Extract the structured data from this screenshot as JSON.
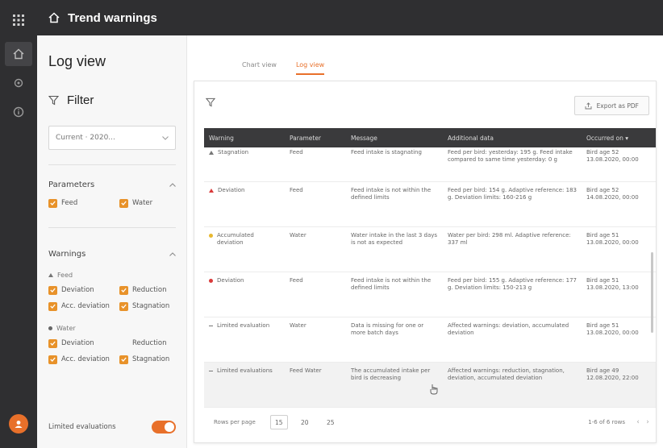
{
  "app": {
    "title": "Trend warnings"
  },
  "sidebar": {
    "page_title": "Log view",
    "filter_label": "Filter",
    "select_value": "Current · 2020...",
    "parameters": {
      "label": "Parameters",
      "items": [
        "Feed",
        "Water"
      ]
    },
    "warnings": {
      "label": "Warnings",
      "group1": {
        "label": "Feed",
        "items": [
          "Deviation",
          "Reduction",
          "Acc. deviation",
          "Stagnation"
        ]
      },
      "group2": {
        "label": "Water",
        "items": [
          "Deviation",
          "Reduction",
          "Acc. deviation",
          "Stagnation"
        ]
      }
    },
    "limited_evaluations_label": "Limited evaluations"
  },
  "tabs": [
    "Chart view",
    "Log view"
  ],
  "toolbar": {
    "export_label": "Export as PDF"
  },
  "table": {
    "columns": [
      "Warning",
      "Parameter",
      "Message",
      "Additional data",
      "Occurred on"
    ],
    "rows": [
      {
        "marker": "tri-dark",
        "warning": "Stagnation",
        "parameter": "Feed",
        "message": "Feed intake is stagnating",
        "additional": "Feed per bird: yesterday: 195 g. Feed intake compared to same time yesterday: 0 g",
        "occurred": "Bird age 52 13.08.2020, 00:00"
      },
      {
        "marker": "tri",
        "warning": "Deviation",
        "parameter": "Feed",
        "message": "Feed intake is not within the defined limits",
        "additional": "Feed per bird: 154 g. Adaptive reference: 183 g. Deviation limits: 160-216 g",
        "occurred": "Bird age 52 14.08.2020, 00:00"
      },
      {
        "marker": "circle",
        "warning": "Accumulated deviation",
        "parameter": "Water",
        "message": "Water intake in the last 3 days is not as expected",
        "additional": "Water per bird: 298 ml. Adaptive reference: 337 ml",
        "occurred": "Bird age 51 13.08.2020, 00:00"
      },
      {
        "marker": "circle-red",
        "warning": "Deviation",
        "parameter": "Feed",
        "message": "Feed intake is not within the defined limits",
        "additional": "Feed per bird: 155 g. Adaptive reference: 177 g. Deviation limits: 150-213 g",
        "occurred": "Bird age 51 13.08.2020, 13:00"
      },
      {
        "marker": "dash",
        "warning": "Limited evaluation",
        "parameter": "Water",
        "message": "Data is missing for one or more batch days",
        "additional": "Affected warnings: deviation, accumulated deviation",
        "occurred": "Bird age 51 13.08.2020, 00:00"
      },
      {
        "marker": "dash",
        "warning": "Limited evaluations",
        "parameter": "Feed Water",
        "message": "The accumulated intake per bird is decreasing",
        "additional": "Affected warnings: reduction, stagnation, deviation, accumulated deviation",
        "occurred": "Bird age 49 12.08.2020, 22:00"
      }
    ]
  },
  "pagination": {
    "rows_per_page_label": "Rows per page",
    "sizes": [
      "15",
      "20",
      "25"
    ],
    "range_text": "1-6 of 6 rows"
  },
  "colors": {
    "accent": "#e8702a",
    "checkbox": "#e8922a",
    "header_dark": "#2f2f31"
  }
}
